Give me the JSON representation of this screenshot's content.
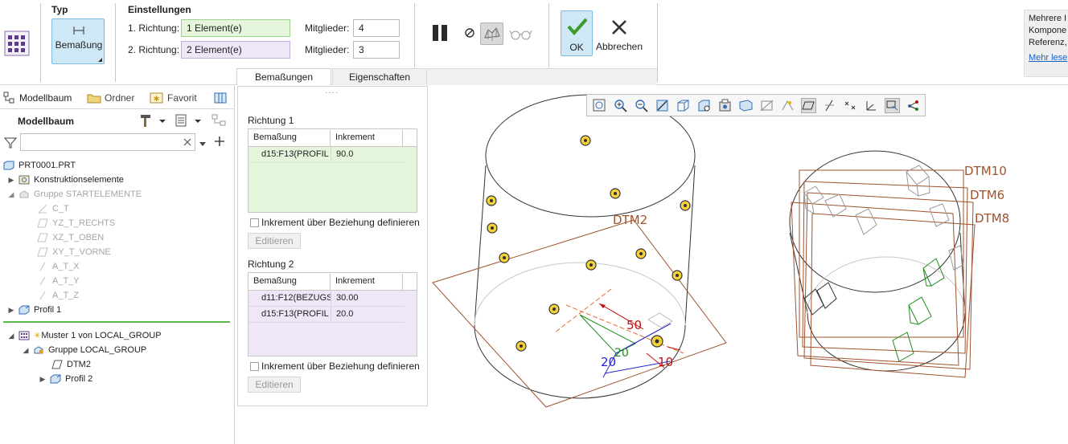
{
  "ribbon": {
    "type_group": {
      "title": "Typ",
      "button_label": "Bemaßung"
    },
    "settings_group": {
      "title": "Einstellungen",
      "dir1_label": "1. Richtung:",
      "dir1_value": "1 Element(e)",
      "dir2_label": "2. Richtung:",
      "dir2_value": "2 Element(e)",
      "members1_label": "Mitglieder:",
      "members1_value": "4",
      "members2_label": "Mitglieder:",
      "members2_value": "3"
    },
    "ok_label": "OK",
    "cancel_label": "Abbrechen",
    "tabs": [
      {
        "label": "Bemaßungen"
      },
      {
        "label": "Eigenschaften"
      }
    ]
  },
  "help_panel": {
    "lines": [
      "Mehrere I",
      "Kompone",
      "Referenz,"
    ],
    "more_link": "Mehr lese"
  },
  "left_panel": {
    "tabs": [
      {
        "label": "Modellbaum"
      },
      {
        "label": "Ordner"
      },
      {
        "label": "Favorit"
      }
    ],
    "title": "Modellbaum",
    "filter_placeholder": "",
    "tree": [
      {
        "label": "PRT0001.PRT",
        "icon": "part-icon",
        "dim": false
      },
      {
        "label": "Konstruktionselemente",
        "icon": "design-items-icon",
        "dim": false
      },
      {
        "label": "Gruppe STARTELEMENTE",
        "icon": "group-icon",
        "dim": true
      },
      {
        "label": "C_T",
        "icon": "axis-icon",
        "dim": true
      },
      {
        "label": "YZ_T_RECHTS",
        "icon": "datum-plane-icon",
        "dim": true
      },
      {
        "label": "XZ_T_OBEN",
        "icon": "datum-plane-icon",
        "dim": true
      },
      {
        "label": "XY_T_VORNE",
        "icon": "datum-plane-icon",
        "dim": true
      },
      {
        "label": "A_T_X",
        "icon": "axis-icon",
        "dim": true
      },
      {
        "label": "A_T_Y",
        "icon": "axis-icon",
        "dim": true
      },
      {
        "label": "A_T_Z",
        "icon": "axis-icon",
        "dim": true
      },
      {
        "label": "Profil 1",
        "icon": "extrude-icon",
        "dim": false
      },
      {
        "label": "Muster 1 von LOCAL_GROUP",
        "icon": "pattern-icon",
        "dim": false
      },
      {
        "label": "Gruppe LOCAL_GROUP",
        "icon": "group-icon",
        "dim": false
      },
      {
        "label": "DTM2",
        "icon": "datum-plane-icon",
        "dim": false
      },
      {
        "label": "Profil 2",
        "icon": "extrude-icon",
        "dim": false
      }
    ]
  },
  "dimensions_panel": {
    "direction1": {
      "title": "Richtung 1",
      "headers": [
        "Bemaßung",
        "Inkrement"
      ],
      "rows": [
        {
          "dim": "d15:F13(PROFIL",
          "inc": "90.0"
        }
      ],
      "checkbox_label": "Inkrement über Beziehung definieren",
      "edit_label": "Editieren"
    },
    "direction2": {
      "title": "Richtung 2",
      "headers": [
        "Bemaßung",
        "Inkrement"
      ],
      "rows": [
        {
          "dim": "d11:F12(BEZUGS",
          "inc": "30.00"
        },
        {
          "dim": "d15:F13(PROFIL",
          "inc": "20.0"
        }
      ],
      "checkbox_label": "Inkrement über Beziehung definieren",
      "edit_label": "Editieren"
    }
  },
  "viewport": {
    "labels": {
      "dtm2": "DTM2",
      "dtm10": "DTM10",
      "dtm6": "DTM6",
      "dtm8": "DTM8",
      "dim50": "50",
      "dim20a": "20",
      "dim20b": "20",
      "dim10": "10"
    },
    "colors": {
      "datum": "#a0522d",
      "selection": "#1e8c1e",
      "dim_red": "#c01010",
      "dim_blue": "#2424cc",
      "marker": "#e6b800"
    }
  }
}
